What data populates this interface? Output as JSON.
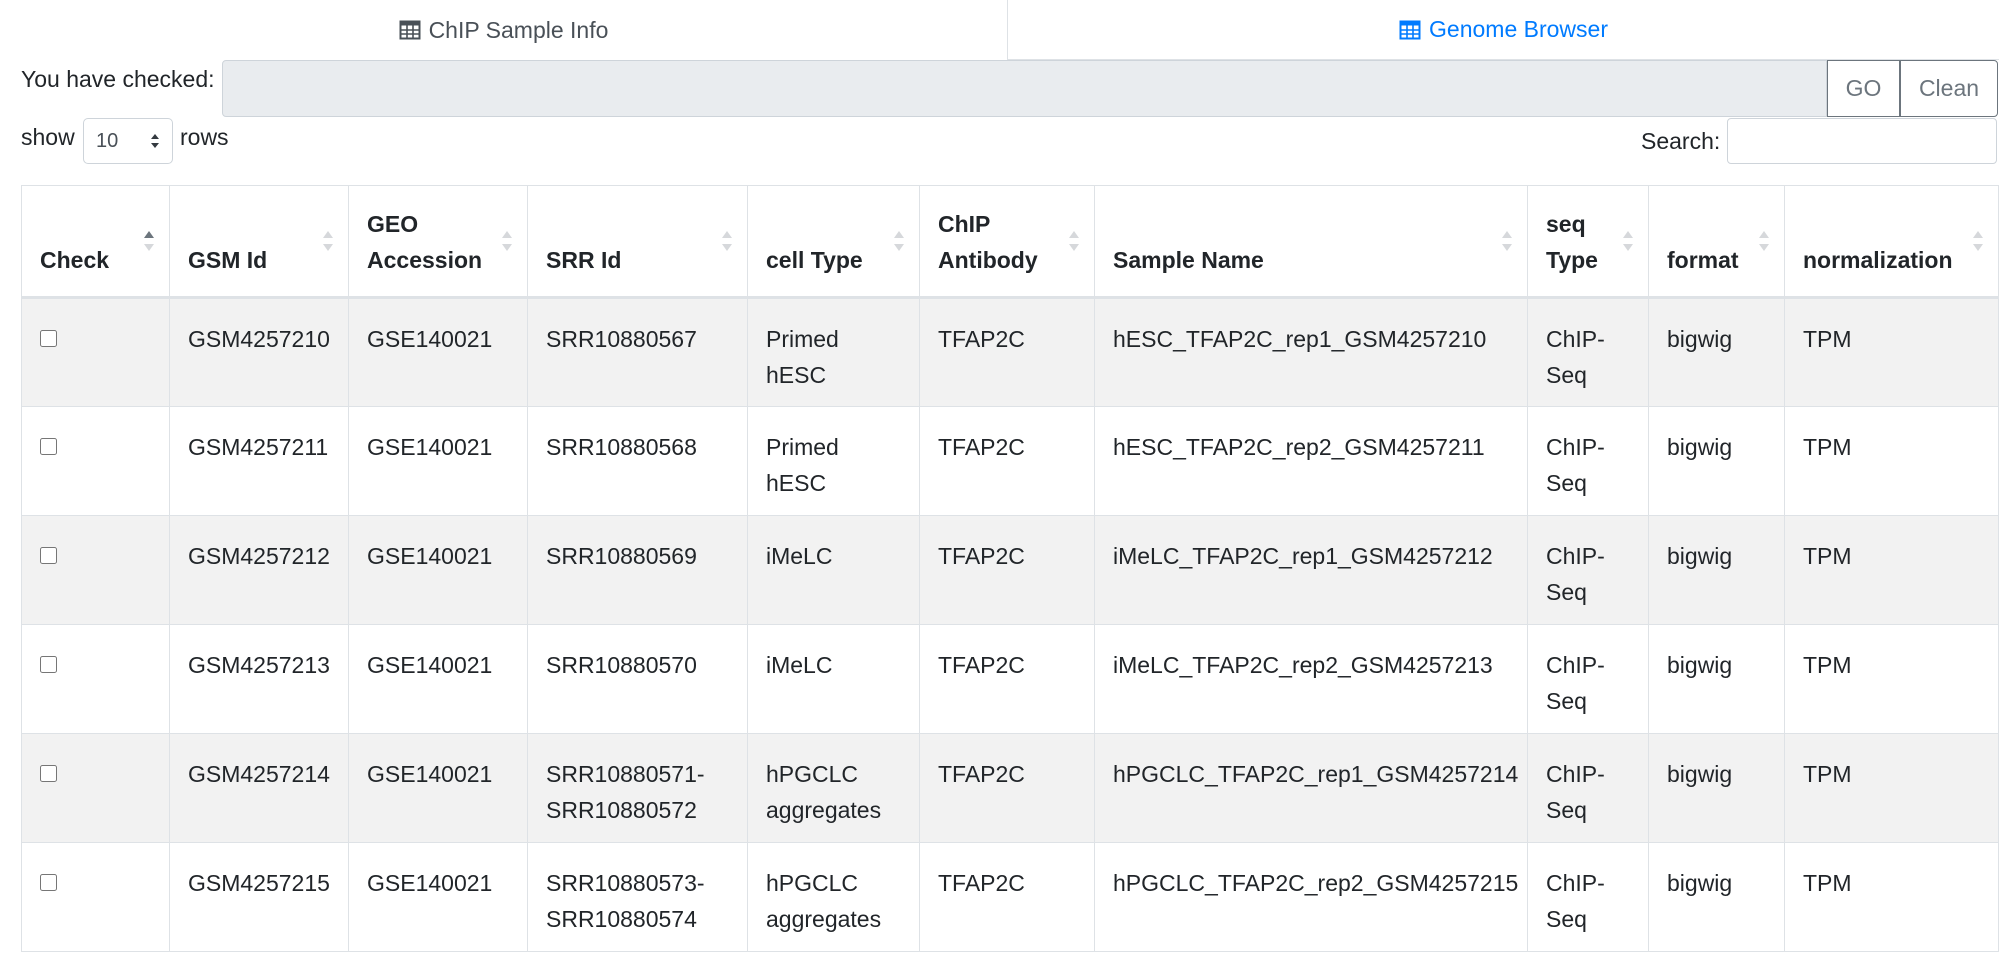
{
  "tabs": [
    {
      "label": "ChIP Sample Info",
      "icon": "table-icon",
      "color": "#495057"
    },
    {
      "label": "Genome Browser",
      "icon": "table-icon",
      "color": "#007bff"
    }
  ],
  "checked": {
    "label": "You have checked:",
    "value": "",
    "go_label": "GO",
    "clean_label": "Clean"
  },
  "length": {
    "show_label": "show",
    "selected": "10",
    "rows_label": "rows"
  },
  "search": {
    "label": "Search:",
    "value": ""
  },
  "table": {
    "columns": [
      [
        "Check"
      ],
      [
        "GSM Id"
      ],
      [
        "GEO",
        "Accession"
      ],
      [
        "SRR Id"
      ],
      [
        "cell Type"
      ],
      [
        "ChIP",
        "Antibody"
      ],
      [
        "Sample Name"
      ],
      [
        "seq",
        "Type"
      ],
      [
        "format"
      ],
      [
        "normalization"
      ]
    ],
    "rows": [
      {
        "gsm": "GSM4257210",
        "geo": "GSE140021",
        "srr": [
          "SRR10880567"
        ],
        "cell": [
          "Primed hESC"
        ],
        "antibody": "TFAP2C",
        "sample": "hESC_TFAP2C_rep1_GSM4257210",
        "seq": [
          "ChIP-",
          "Seq"
        ],
        "format": "bigwig",
        "norm": "TPM"
      },
      {
        "gsm": "GSM4257211",
        "geo": "GSE140021",
        "srr": [
          "SRR10880568"
        ],
        "cell": [
          "Primed hESC"
        ],
        "antibody": "TFAP2C",
        "sample": "hESC_TFAP2C_rep2_GSM4257211",
        "seq": [
          "ChIP-",
          "Seq"
        ],
        "format": "bigwig",
        "norm": "TPM"
      },
      {
        "gsm": "GSM4257212",
        "geo": "GSE140021",
        "srr": [
          "SRR10880569"
        ],
        "cell": [
          "iMeLC"
        ],
        "antibody": "TFAP2C",
        "sample": "iMeLC_TFAP2C_rep1_GSM4257212",
        "seq": [
          "ChIP-",
          "Seq"
        ],
        "format": "bigwig",
        "norm": "TPM"
      },
      {
        "gsm": "GSM4257213",
        "geo": "GSE140021",
        "srr": [
          "SRR10880570"
        ],
        "cell": [
          "iMeLC"
        ],
        "antibody": "TFAP2C",
        "sample": "iMeLC_TFAP2C_rep2_GSM4257213",
        "seq": [
          "ChIP-",
          "Seq"
        ],
        "format": "bigwig",
        "norm": "TPM"
      },
      {
        "gsm": "GSM4257214",
        "geo": "GSE140021",
        "srr": [
          "SRR10880571-",
          "SRR10880572"
        ],
        "cell": [
          "hPGCLC",
          "aggregates"
        ],
        "antibody": "TFAP2C",
        "sample": "hPGCLC_TFAP2C_rep1_GSM4257214",
        "seq": [
          "ChIP-",
          "Seq"
        ],
        "format": "bigwig",
        "norm": "TPM"
      },
      {
        "gsm": "GSM4257215",
        "geo": "GSE140021",
        "srr": [
          "SRR10880573-",
          "SRR10880574"
        ],
        "cell": [
          "hPGCLC",
          "aggregates"
        ],
        "antibody": "TFAP2C",
        "sample": "hPGCLC_TFAP2C_rep2_GSM4257215",
        "seq": [
          "ChIP-",
          "Seq"
        ],
        "format": "bigwig",
        "norm": "TPM"
      }
    ]
  }
}
